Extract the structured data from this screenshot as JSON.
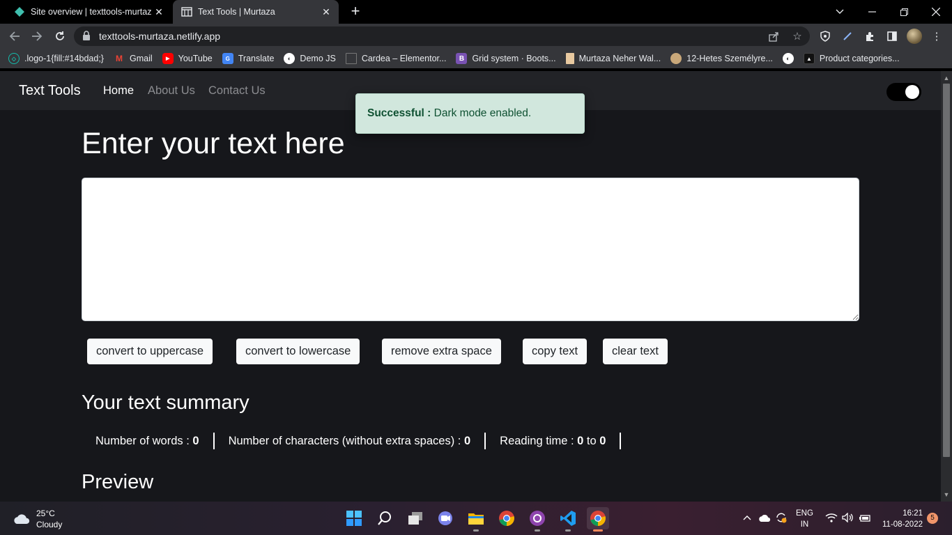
{
  "tabs": [
    {
      "title": "Site overview | texttools-murtaza",
      "favicon": "netlify-diamond-icon",
      "active": false
    },
    {
      "title": "Text Tools | Murtaza",
      "favicon": "page-icon",
      "active": true
    }
  ],
  "address_bar": {
    "url": "texttools-murtaza.netlify.app"
  },
  "bookmarks": [
    {
      "label": ".logo-1{fill:#14bdad;}",
      "icon": "logo-icon",
      "color": "#14bdad"
    },
    {
      "label": "Gmail",
      "icon": "gmail-icon",
      "color": "#ea4335"
    },
    {
      "label": "YouTube",
      "icon": "youtube-icon",
      "color": "#ff0000"
    },
    {
      "label": "Translate",
      "icon": "translate-icon",
      "color": "#4285f4"
    },
    {
      "label": "Demo JS",
      "icon": "globe-icon",
      "color": "#ffffff"
    },
    {
      "label": "Cardea – Elementor...",
      "icon": "elementor-icon",
      "color": "#666666"
    },
    {
      "label": "Grid system · Boots...",
      "icon": "bootstrap-icon",
      "color": "#7952b3"
    },
    {
      "label": "Murtaza Neher Wal...",
      "icon": "document-icon",
      "color": "#e8c9a0"
    },
    {
      "label": "12-Hetes Személyre...",
      "icon": "person-icon",
      "color": "#c9a87a"
    },
    {
      "label": "",
      "icon": "globe-icon",
      "color": "#ffffff"
    },
    {
      "label": "Product categories...",
      "icon": "product-icon",
      "color": "#222222"
    }
  ],
  "navbar": {
    "brand": "Text Tools",
    "links": [
      {
        "label": "Home",
        "active": true
      },
      {
        "label": "About Us",
        "active": false
      },
      {
        "label": "Contact Us",
        "active": false
      }
    ]
  },
  "alert": {
    "strong": "Successful :",
    "message": "Dark mode enabled."
  },
  "main": {
    "heading": "Enter your text here",
    "textarea_value": "",
    "buttons": [
      "convert to uppercase",
      "convert to lowercase",
      "remove extra space",
      "copy text",
      "clear text"
    ],
    "summary_heading": "Your text summary",
    "stats": [
      {
        "label": "Number of words : ",
        "value": "0"
      },
      {
        "label": "Number of characters (without extra spaces) : ",
        "value": "0"
      },
      {
        "label": "Reading time : ",
        "value": "0",
        "mid": " to ",
        "value2": "0"
      }
    ],
    "preview_heading": "Preview"
  },
  "taskbar": {
    "weather": {
      "temp": "25°C",
      "condition": "Cloudy"
    },
    "language": {
      "line1": "ENG",
      "line2": "IN"
    },
    "clock": {
      "time": "16:21",
      "date": "11-08-2022"
    },
    "notifications": "5"
  },
  "colors": {
    "page_bg": "#16171b",
    "navbar_bg": "#222327",
    "alert_bg": "#d1e7dd",
    "alert_text": "#0f5132"
  }
}
